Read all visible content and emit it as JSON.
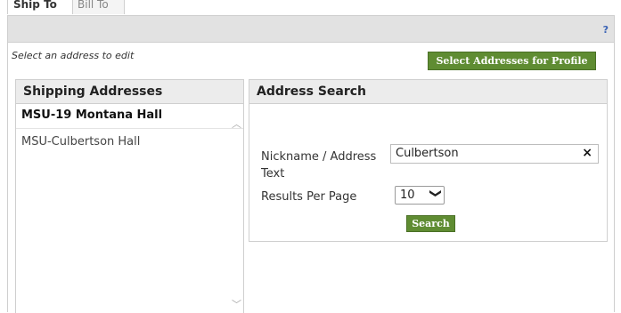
{
  "tabs": [
    {
      "label": "Ship To"
    },
    {
      "label": "Bill To"
    }
  ],
  "toolbar": {
    "help_label": "?"
  },
  "hint_text": "Select an address to edit",
  "select_button_label": "Select Addresses for Profile",
  "shipping": {
    "title": "Shipping Addresses",
    "items": [
      {
        "label": "MSU-19 Montana Hall"
      },
      {
        "label": "MSU-Culbertson Hall"
      }
    ]
  },
  "search": {
    "title": "Address Search",
    "nickname_label": "Nickname / Address Text",
    "nickname_value": "Culbertson",
    "clear_icon": "×",
    "results_label": "Results Per Page",
    "results_value": "10",
    "search_button_label": "Search"
  },
  "icons": {
    "scroll_up": "︿",
    "scroll_down": "﹀",
    "chevron_down": "❯"
  },
  "colors": {
    "accent_green": "#5f8c32",
    "toolbar_gray": "#e2e2e2",
    "help_blue": "#3a63b5"
  }
}
